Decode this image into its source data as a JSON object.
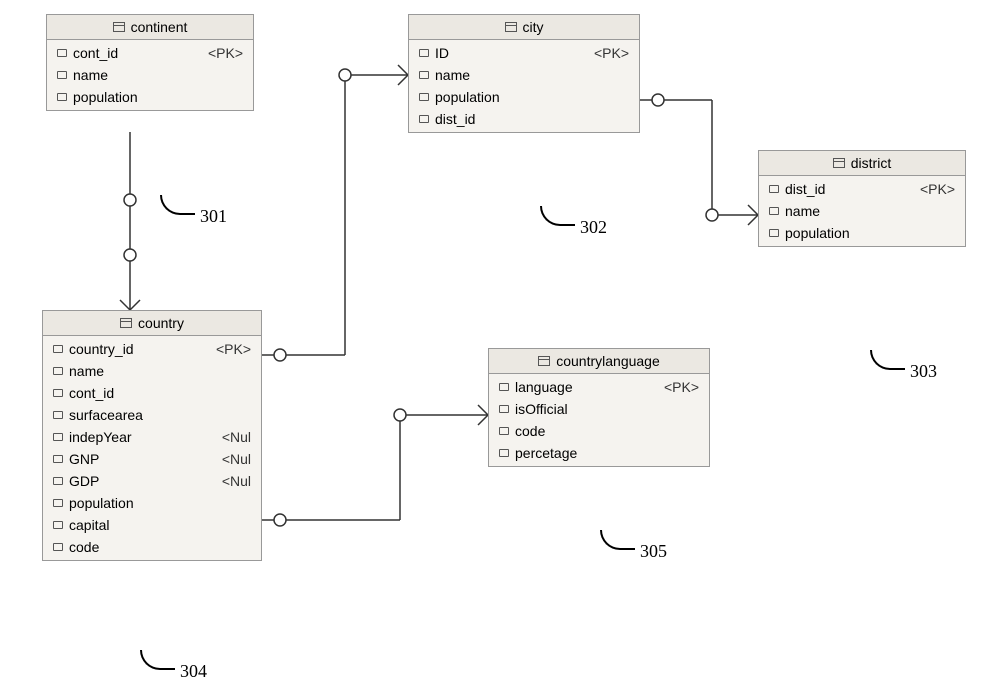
{
  "entities": {
    "continent": {
      "title": "continent",
      "ref": "301",
      "attrs": [
        {
          "name": "cont_id",
          "tag": "<PK>"
        },
        {
          "name": "name",
          "tag": ""
        },
        {
          "name": "population",
          "tag": ""
        }
      ]
    },
    "city": {
      "title": "city",
      "ref": "302",
      "attrs": [
        {
          "name": "ID",
          "tag": "<PK>"
        },
        {
          "name": "name",
          "tag": ""
        },
        {
          "name": "population",
          "tag": ""
        },
        {
          "name": "dist_id",
          "tag": ""
        }
      ]
    },
    "district": {
      "title": "district",
      "ref": "303",
      "attrs": [
        {
          "name": "dist_id",
          "tag": "<PK>"
        },
        {
          "name": "name",
          "tag": ""
        },
        {
          "name": "population",
          "tag": ""
        }
      ]
    },
    "country": {
      "title": "country",
      "ref": "304",
      "attrs": [
        {
          "name": "country_id",
          "tag": "<PK>"
        },
        {
          "name": "name",
          "tag": ""
        },
        {
          "name": "cont_id",
          "tag": ""
        },
        {
          "name": "surfacearea",
          "tag": ""
        },
        {
          "name": "indepYear",
          "tag": "<Nul"
        },
        {
          "name": "GNP",
          "tag": "<Nul"
        },
        {
          "name": "GDP",
          "tag": "<Nul"
        },
        {
          "name": "population",
          "tag": ""
        },
        {
          "name": "capital",
          "tag": ""
        },
        {
          "name": "code",
          "tag": ""
        }
      ]
    },
    "countrylanguage": {
      "title": "countrylanguage",
      "ref": "305",
      "attrs": [
        {
          "name": "language",
          "tag": "<PK>"
        },
        {
          "name": "isOfficial",
          "tag": ""
        },
        {
          "name": "code",
          "tag": ""
        },
        {
          "name": "percetage",
          "tag": ""
        }
      ]
    }
  }
}
